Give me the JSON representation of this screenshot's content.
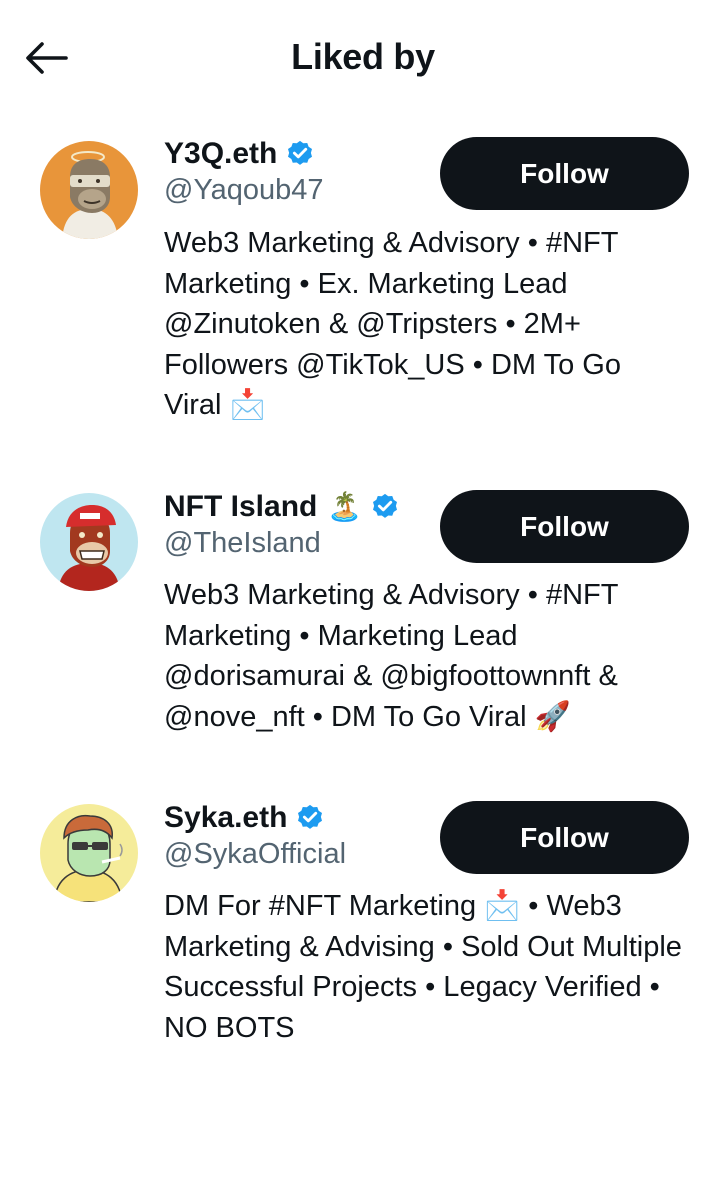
{
  "header": {
    "title": "Liked by"
  },
  "users": [
    {
      "name": "Y3Q.eth",
      "handle": "@Yaqoub47",
      "bio": "Web3 Marketing & Advisory • #NFT Marketing • Ex. Marketing Lead @Zinutoken & @Tripsters • 2M+ Followers @TikTok_US • DM To Go Viral 📩",
      "follow_label": "Follow",
      "verified": true,
      "avatar_bg": "#e8953a"
    },
    {
      "name": "NFT Island",
      "name_emoji": "🏝️",
      "handle": "@TheIsland",
      "bio": "Web3 Marketing & Advisory • #NFT Marketing • Marketing Lead @dorisamurai & @bigfoottownnft & @nove_nft • DM To Go Viral 🚀",
      "follow_label": "Follow",
      "verified": true,
      "avatar_bg": "#bfe6f0"
    },
    {
      "name": "Syka.eth",
      "handle": "@SykaOfficial",
      "bio": "DM For #NFT Marketing 📩 • Web3 Marketing & Advising • Sold Out Multiple Successful Projects • Legacy Verified • NO BOTS",
      "follow_label": "Follow",
      "verified": true,
      "avatar_bg": "#f5ec9a"
    }
  ],
  "colors": {
    "verified_blue": "#1d9bf0",
    "follow_bg": "#0f1419",
    "handle_gray": "#536471"
  }
}
